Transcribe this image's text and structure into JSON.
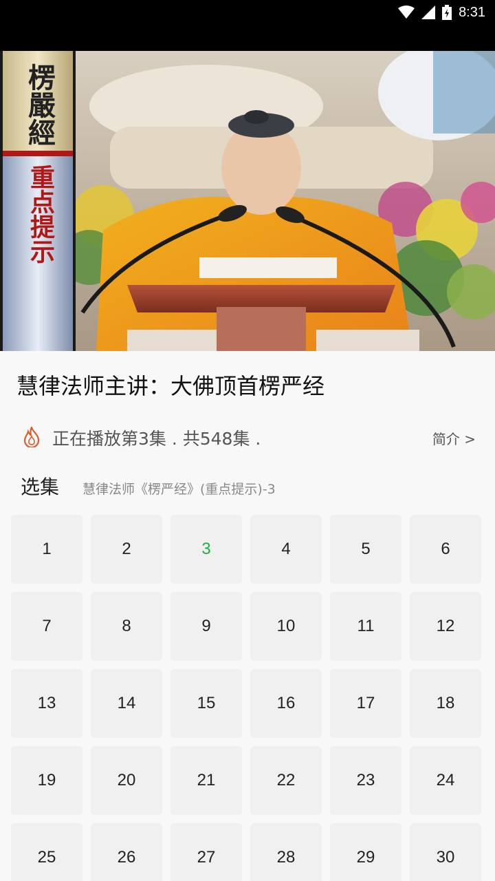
{
  "status_bar": {
    "time": "8:31"
  },
  "video": {
    "overlay_title": "楞嚴經",
    "overlay_subtitle": "重点提示"
  },
  "detail": {
    "title": "慧律法师主讲：大佛顶首楞严经",
    "play_status": "正在播放第3集 . 共548集 .",
    "intro_link": "简介 >"
  },
  "episodes": {
    "label": "选集",
    "current_episode_title": "慧律法师《楞严经》(重点提示)-3",
    "current": "3",
    "items": [
      "1",
      "2",
      "3",
      "4",
      "5",
      "6",
      "7",
      "8",
      "9",
      "10",
      "11",
      "12",
      "13",
      "14",
      "15",
      "16",
      "17",
      "18",
      "19",
      "20",
      "21",
      "22",
      "23",
      "24",
      "25",
      "26",
      "27",
      "28",
      "29",
      "30"
    ]
  },
  "colors": {
    "active_episode": "#1bb13a",
    "fire_icon": "#e05a2b"
  }
}
